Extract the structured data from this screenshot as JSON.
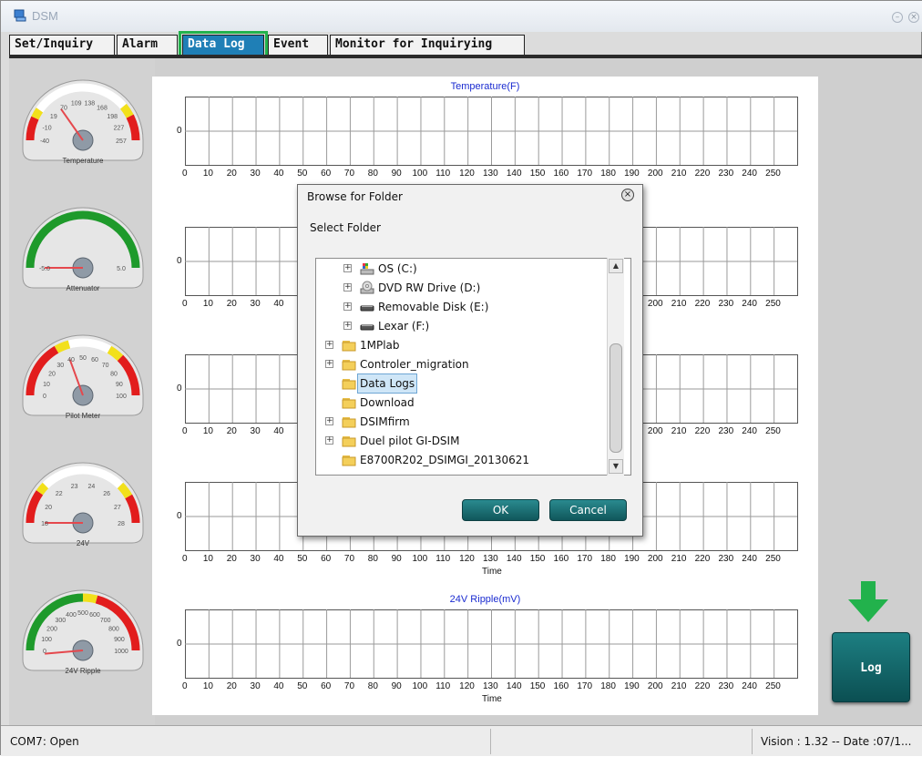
{
  "window": {
    "title": "DSM",
    "tabs": [
      "Set/Inquiry",
      "Alarm",
      "Data Log",
      "Event",
      "Monitor for Inquirying"
    ],
    "active_tab": "Data Log"
  },
  "gauges": [
    {
      "label": "Temperature",
      "scale": [
        "-40",
        "-10",
        "19",
        "70",
        "109",
        "138",
        "168",
        "198",
        "227",
        "257"
      ]
    },
    {
      "label": "Attenuator",
      "scale": [
        "-5.0",
        "5.0"
      ]
    },
    {
      "label": "Pilot Meter",
      "scale": [
        "0",
        "10",
        "20",
        "30",
        "40",
        "50",
        "60",
        "70",
        "80",
        "90",
        "100"
      ]
    },
    {
      "label": "24V",
      "scale": [
        "18",
        "20",
        "22",
        "23",
        "24",
        "26",
        "27",
        "28"
      ]
    },
    {
      "label": "24V Ripple",
      "scale": [
        "0",
        "100",
        "200",
        "300",
        "400",
        "500",
        "600",
        "700",
        "800",
        "900",
        "1000"
      ]
    }
  ],
  "charts": [
    {
      "title": "Temperature(F)",
      "ylabel": "0",
      "xlabel": ""
    },
    {
      "title": "",
      "ylabel": "0",
      "xlabel": ""
    },
    {
      "title": "",
      "ylabel": "0",
      "xlabel": ""
    },
    {
      "title": "",
      "ylabel": "0",
      "xlabel": "Time"
    },
    {
      "title": "24V Ripple(mV)",
      "ylabel": "0",
      "xlabel": "Time"
    }
  ],
  "x_ticks": [
    "0",
    "10",
    "20",
    "30",
    "40",
    "50",
    "60",
    "70",
    "80",
    "90",
    "100",
    "110",
    "120",
    "130",
    "140",
    "150",
    "160",
    "170",
    "180",
    "190",
    "200",
    "210",
    "220",
    "230",
    "240",
    "250"
  ],
  "dialog": {
    "title": "Browse for Folder",
    "subtitle": "Select Folder",
    "ok_label": "OK",
    "cancel_label": "Cancel",
    "tree": [
      {
        "label": "OS (C:)",
        "level": 1,
        "type": "drive-c",
        "expandable": true
      },
      {
        "label": "DVD RW Drive (D:)",
        "level": 1,
        "type": "dvd",
        "expandable": true
      },
      {
        "label": "Removable Disk (E:)",
        "level": 1,
        "type": "removable",
        "expandable": true
      },
      {
        "label": "Lexar (F:)",
        "level": 1,
        "type": "removable",
        "expandable": true
      },
      {
        "label": "1MPlab",
        "level": 0,
        "type": "folder",
        "expandable": true
      },
      {
        "label": "Controler_migration",
        "level": 0,
        "type": "folder",
        "expandable": true
      },
      {
        "label": "Data Logs",
        "level": 0,
        "type": "folder",
        "expandable": false,
        "selected": true
      },
      {
        "label": "Download",
        "level": 0,
        "type": "folder",
        "expandable": false
      },
      {
        "label": "DSIMfirm",
        "level": 0,
        "type": "folder",
        "expandable": true
      },
      {
        "label": "Duel pilot GI-DSIM",
        "level": 0,
        "type": "folder",
        "expandable": true
      },
      {
        "label": "E8700R202_DSIMGI_20130621",
        "level": 0,
        "type": "folder",
        "expandable": false
      }
    ]
  },
  "log_button": {
    "label": "Log"
  },
  "status": {
    "port": "COM7: Open",
    "version": "Vision : 1.32  --  Date :07/1..."
  },
  "colors": {
    "accent": "#1f7fb6",
    "highlight": "#22b24c",
    "chart_title": "#1a2bd0",
    "button": "#10575b"
  }
}
